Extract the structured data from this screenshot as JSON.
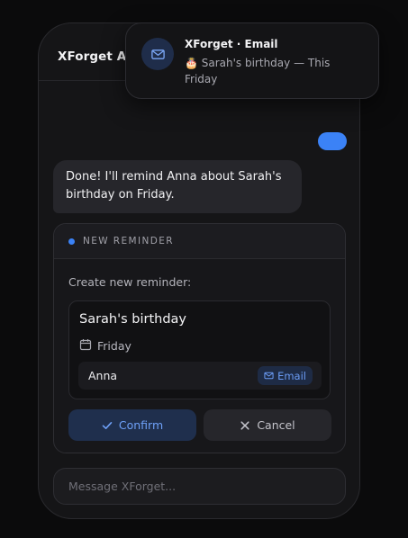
{
  "app": {
    "title": "XForget AI"
  },
  "chat": {
    "assistant_message": "Done! I'll remind Anna about Sarah's birthday on Friday."
  },
  "reminder_card": {
    "header_label": "NEW REMINDER",
    "prompt": "Create new reminder:",
    "title": "Sarah's birthday",
    "date": "Friday",
    "recipient": "Anna",
    "channel": "Email",
    "confirm_label": "Confirm",
    "cancel_label": "Cancel"
  },
  "composer": {
    "placeholder": "Message XForget..."
  },
  "notification": {
    "title": "XForget · Email",
    "body": "🎂 Sarah's birthday — This Friday"
  },
  "colors": {
    "accent": "#3b82f6",
    "background": "#0b0b0c",
    "surface": "#151517"
  },
  "icons": {
    "notification": "mail-icon",
    "date": "calendar-icon",
    "channel": "mail-icon",
    "confirm": "check-icon",
    "cancel": "x-icon"
  }
}
